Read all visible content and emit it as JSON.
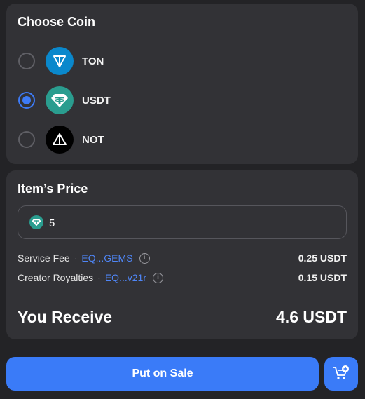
{
  "choose_coin": {
    "title": "Choose Coin",
    "coins": [
      {
        "name": "TON",
        "icon": "ton-icon",
        "color": "#0a88cc",
        "selected": false
      },
      {
        "name": "USDT",
        "icon": "usdt-icon",
        "color": "#2a9d8f",
        "selected": true
      },
      {
        "name": "NOT",
        "icon": "not-icon",
        "color": "#000000",
        "selected": false
      }
    ]
  },
  "price": {
    "title": "Item’s Price",
    "value": "5",
    "fees": [
      {
        "label": "Service Fee",
        "address": "EQ...GEMS",
        "amount": "0.25 USDT"
      },
      {
        "label": "Creator Royalties",
        "address": "EQ...v21r",
        "amount": "0.15 USDT"
      }
    ],
    "receive_label": "You Receive",
    "receive_amount": "4.6 USDT"
  },
  "actions": {
    "put_on_sale": "Put on Sale",
    "cart_icon": "add-to-cart-icon"
  },
  "colors": {
    "accent": "#3a7bf8",
    "link": "#4f86f7",
    "card": "#323236",
    "background": "#232326"
  }
}
